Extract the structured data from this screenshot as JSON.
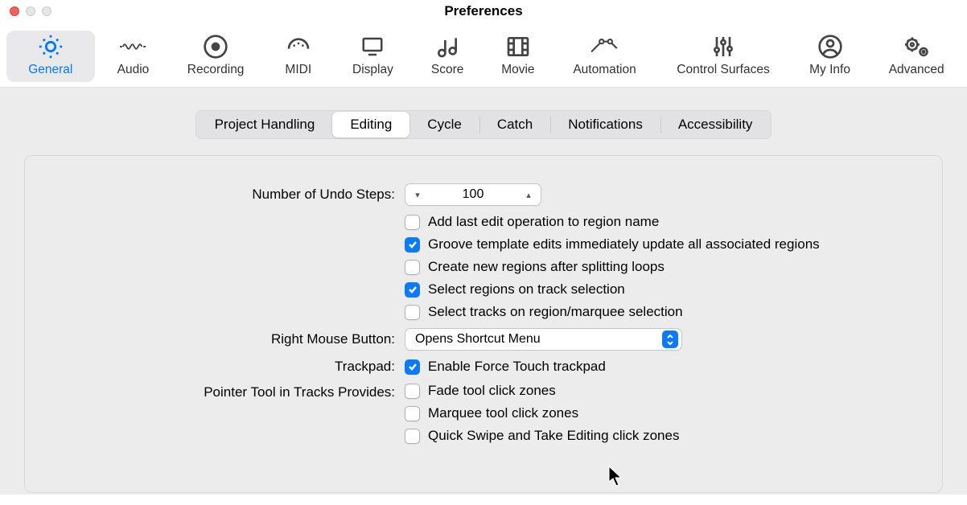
{
  "window": {
    "title": "Preferences"
  },
  "toolbar": {
    "items": [
      {
        "name": "general",
        "label": "General",
        "selected": true
      },
      {
        "name": "audio",
        "label": "Audio",
        "selected": false
      },
      {
        "name": "recording",
        "label": "Recording",
        "selected": false
      },
      {
        "name": "midi",
        "label": "MIDI",
        "selected": false
      },
      {
        "name": "display",
        "label": "Display",
        "selected": false
      },
      {
        "name": "score",
        "label": "Score",
        "selected": false
      },
      {
        "name": "movie",
        "label": "Movie",
        "selected": false
      },
      {
        "name": "automation",
        "label": "Automation",
        "selected": false
      },
      {
        "name": "control-surfaces",
        "label": "Control Surfaces",
        "selected": false
      },
      {
        "name": "my-info",
        "label": "My Info",
        "selected": false
      },
      {
        "name": "advanced",
        "label": "Advanced",
        "selected": false
      }
    ]
  },
  "subtabs": {
    "items": [
      {
        "name": "project-handling",
        "label": "Project Handling",
        "active": false
      },
      {
        "name": "editing",
        "label": "Editing",
        "active": true
      },
      {
        "name": "cycle",
        "label": "Cycle",
        "active": false
      },
      {
        "name": "catch",
        "label": "Catch",
        "active": false
      },
      {
        "name": "notifications",
        "label": "Notifications",
        "active": false
      },
      {
        "name": "accessibility",
        "label": "Accessibility",
        "active": false
      }
    ]
  },
  "settings": {
    "undo_label": "Number of Undo Steps:",
    "undo_value": "100",
    "checkbox_block1": [
      {
        "key": "add-last-edit",
        "label": "Add last edit operation to region name",
        "checked": false
      },
      {
        "key": "groove-template",
        "label": "Groove template edits immediately update all associated regions",
        "checked": true
      },
      {
        "key": "create-new-regions",
        "label": "Create new regions after splitting loops",
        "checked": false
      },
      {
        "key": "select-regions-track",
        "label": "Select regions on track selection",
        "checked": true
      },
      {
        "key": "select-tracks-region",
        "label": "Select tracks on region/marquee selection",
        "checked": false
      }
    ],
    "right_mouse_label": "Right Mouse Button:",
    "right_mouse_value": "Opens Shortcut Menu",
    "trackpad_label": "Trackpad:",
    "trackpad_checkbox": {
      "key": "force-touch",
      "label": "Enable Force Touch trackpad",
      "checked": true
    },
    "pointer_label": "Pointer Tool in Tracks Provides:",
    "checkbox_block2": [
      {
        "key": "fade-tool-zones",
        "label": "Fade tool click zones",
        "checked": false
      },
      {
        "key": "marquee-tool-zones",
        "label": "Marquee tool click zones",
        "checked": false
      },
      {
        "key": "quick-swipe-zones",
        "label": "Quick Swipe and Take Editing click zones",
        "checked": false
      }
    ]
  }
}
